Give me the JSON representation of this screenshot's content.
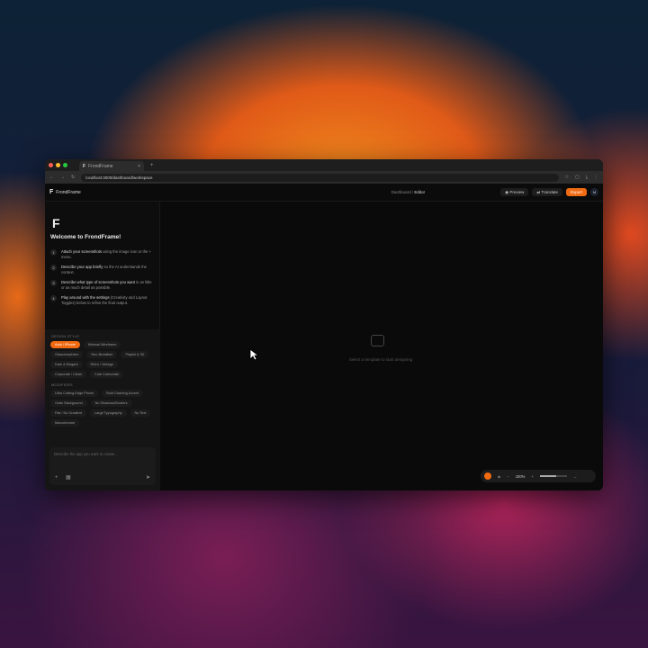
{
  "browser": {
    "tab_title": "FrondFrame",
    "url": "localhost:3000/dashboard/workspace",
    "new_tab": "+",
    "close": "×"
  },
  "app": {
    "name": "FrondFrame",
    "breadcrumb": {
      "parent": "Dashboard",
      "sep": "/",
      "current": "Editor"
    },
    "buttons": {
      "preview": "Preview",
      "translate": "Translate",
      "export": "Export"
    },
    "avatar": "M"
  },
  "sidebar": {
    "welcome": "Welcome to FrondFrame!",
    "steps": [
      {
        "n": "1",
        "bold": "Attach your screenshots",
        "text": " using the image icon or the + menu."
      },
      {
        "n": "2",
        "bold": "Describe your app briefly",
        "text": " so the AI understands the context."
      },
      {
        "n": "3",
        "bold": "Describe what type of screenshots you want",
        "text": " in as little or as much detail as possible."
      },
      {
        "n": "4",
        "bold": "Play around with the settings",
        "text": " (Creativity and Layout Toggles) below to refine the final output."
      }
    ],
    "style_label": "DESIGN STYLE",
    "styles": [
      "Auto / iPhone",
      "Minimal Wireframe",
      "Glassmorphism",
      "Neo-Brutalism",
      "Playful & 3D",
      "Dark & Elegant",
      "Retro / Vintage",
      "Corporate / Clean",
      "Cute Cartoonish"
    ],
    "modifiers_label": "MODIFIERS",
    "modifiers": [
      "Ultra Cutting-Edge Phone",
      "Bold Clashing Accent",
      "Grain Background",
      "No Shadows/Borders",
      "Flat / No Gradient",
      "Large Typography",
      "No Text",
      "Monochrome"
    ],
    "prompt_placeholder": "Describe the app you want to create...",
    "add_icon": "+",
    "image_icon": "▦"
  },
  "canvas": {
    "empty_text": "Select a template to start designing",
    "zoom": "100%",
    "minus": "−",
    "plus": "+"
  },
  "colors": {
    "accent": "#f06a12"
  }
}
